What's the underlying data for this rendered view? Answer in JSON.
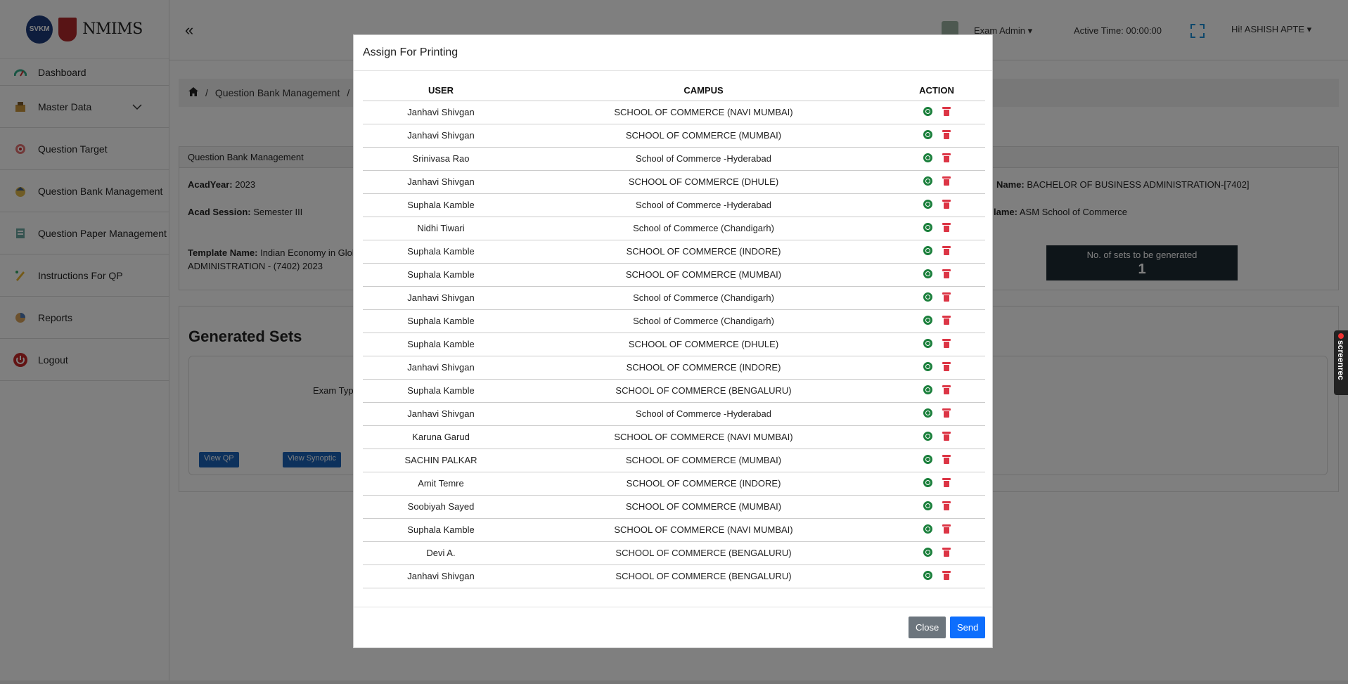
{
  "sidebar": {
    "logo_left": "SVKM",
    "logo_right": "NMIMS",
    "items": [
      {
        "label": "Dashboard",
        "icon": "gauge-icon"
      },
      {
        "label": "Master Data",
        "icon": "database-icon"
      },
      {
        "label": "Question Target",
        "icon": "target-icon"
      },
      {
        "label": "Question Bank Management",
        "icon": "bank-icon"
      },
      {
        "label": "Question Paper Management",
        "icon": "paper-icon"
      },
      {
        "label": "Instructions For QP",
        "icon": "pencil-icon"
      },
      {
        "label": "Reports",
        "icon": "chart-icon"
      },
      {
        "label": "Logout",
        "icon": "power-icon"
      }
    ]
  },
  "topbar": {
    "collapse": "«",
    "role": "Exam Admin ▾",
    "active_time": "Active Time: 00:00:00",
    "user": "Hi! ASHISH APTE ▾"
  },
  "breadcrumb": {
    "item1": "Question Bank Management",
    "sep": "/"
  },
  "details": {
    "header": "Question Bank Management",
    "acad_year_label": "AcadYear:",
    "acad_year": "2023",
    "acad_session_label": "Acad Session:",
    "acad_session": "Semester III",
    "template_label": "Template Name:",
    "template_value": "Indian Economy in Glob",
    "template_value2": "ADMINISTRATION - (7402) 2023",
    "program_label": "Name:",
    "program_value": "BACHELOR OF BUSINESS ADMINISTRATION-[7402]",
    "school_label": "lame:",
    "school_value": "ASM School of Commerce",
    "sets_label": "No. of sets to be generated",
    "sets_value": "1"
  },
  "generated": {
    "title": "Generated Sets",
    "exam_type": "Exam Type",
    "view_qp": "View QP",
    "view_synoptic": "View Synoptic"
  },
  "modal": {
    "title": "Assign For Printing",
    "columns": [
      "USER",
      "CAMPUS",
      "ACTION"
    ],
    "rows": [
      {
        "user": "Janhavi Shivgan",
        "campus": "SCHOOL OF COMMERCE (NAVI MUMBAI)"
      },
      {
        "user": "Janhavi Shivgan",
        "campus": "SCHOOL OF COMMERCE (MUMBAI)"
      },
      {
        "user": "Srinivasa Rao",
        "campus": "School of Commerce -Hyderabad"
      },
      {
        "user": "Janhavi Shivgan",
        "campus": "SCHOOL OF COMMERCE (DHULE)"
      },
      {
        "user": "Suphala Kamble",
        "campus": "School of Commerce -Hyderabad"
      },
      {
        "user": "Nidhi Tiwari",
        "campus": "School of Commerce (Chandigarh)"
      },
      {
        "user": "Suphala Kamble",
        "campus": "SCHOOL OF COMMERCE (INDORE)"
      },
      {
        "user": "Suphala Kamble",
        "campus": "SCHOOL OF COMMERCE (MUMBAI)"
      },
      {
        "user": "Janhavi Shivgan",
        "campus": "School of Commerce (Chandigarh)"
      },
      {
        "user": "Suphala Kamble",
        "campus": "School of Commerce (Chandigarh)"
      },
      {
        "user": "Suphala Kamble",
        "campus": "SCHOOL OF COMMERCE (DHULE)"
      },
      {
        "user": "Janhavi Shivgan",
        "campus": "SCHOOL OF COMMERCE (INDORE)"
      },
      {
        "user": "Suphala Kamble",
        "campus": "SCHOOL OF COMMERCE (BENGALURU)"
      },
      {
        "user": "Janhavi Shivgan",
        "campus": "School of Commerce -Hyderabad"
      },
      {
        "user": "Karuna Garud",
        "campus": "SCHOOL OF COMMERCE (NAVI MUMBAI)"
      },
      {
        "user": "SACHIN PALKAR",
        "campus": "SCHOOL OF COMMERCE (MUMBAI)"
      },
      {
        "user": "Amit Temre",
        "campus": "SCHOOL OF COMMERCE (INDORE)"
      },
      {
        "user": "Soobiyah Sayed",
        "campus": "SCHOOL OF COMMERCE (MUMBAI)"
      },
      {
        "user": "Suphala Kamble",
        "campus": "SCHOOL OF COMMERCE (NAVI MUMBAI)"
      },
      {
        "user": "Devi A.",
        "campus": "SCHOOL OF COMMERCE (BENGALURU)"
      },
      {
        "user": "Janhavi Shivgan",
        "campus": "SCHOOL OF COMMERCE (BENGALURU)"
      }
    ],
    "close_label": "Close",
    "send_label": "Send"
  },
  "screenrec_label": "screenrec",
  "colors": {
    "primary": "#0d6efd",
    "secondary": "#6c757d",
    "success": "#1a7f3b",
    "danger": "#dc3545",
    "dark_box": "#1d2a33"
  }
}
